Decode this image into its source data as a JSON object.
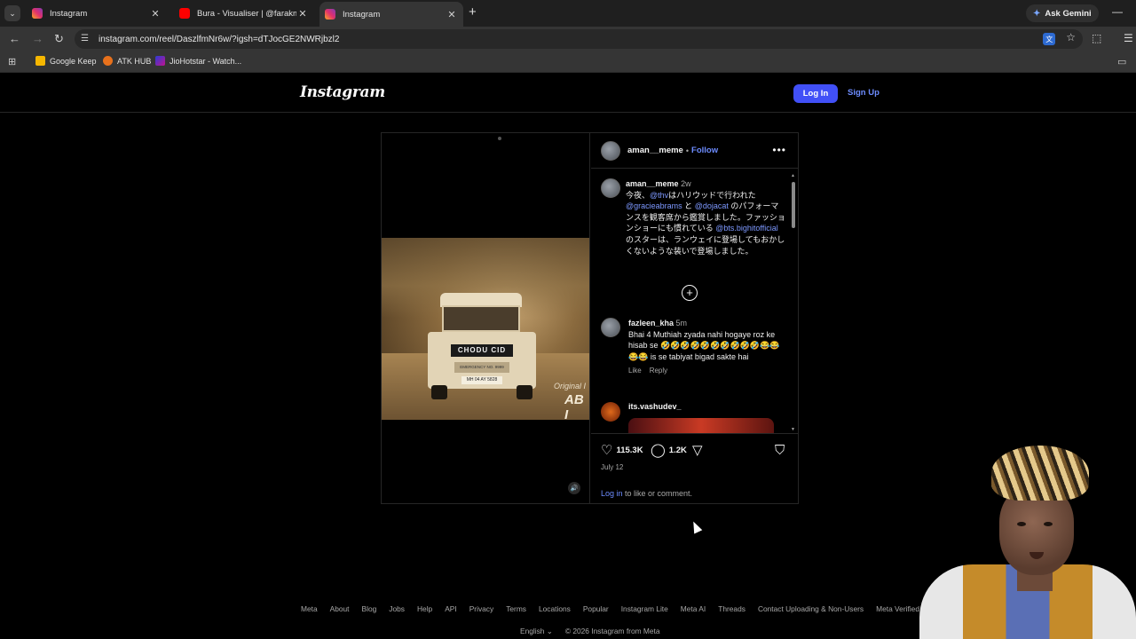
{
  "browser": {
    "tabs": [
      {
        "title": "Instagram",
        "favicon": "instagram-favicon",
        "active": false
      },
      {
        "title": "Bura - Visualiser | @farakmaybe",
        "favicon": "youtube-favicon",
        "active": false
      },
      {
        "title": "Instagram",
        "favicon": "instagram-favicon",
        "active": true
      }
    ],
    "ask_gemini": "Ask Gemini",
    "url": "instagram.com/reel/DaszlfmNr6w/?igsh=dTJocGE2NWRjbzl2",
    "bookmarks": [
      {
        "label": "Google Keep",
        "icon": "google-keep-icon"
      },
      {
        "label": "ATK HUB",
        "icon": "atk-hub-icon"
      },
      {
        "label": "JioHotstar - Watch...",
        "icon": "jiohotstar-icon"
      }
    ]
  },
  "header": {
    "logo": "Instagram",
    "login": "Log In",
    "signup": "Sign Up"
  },
  "post": {
    "video": {
      "plate_text": "CHODU CID",
      "plate_sub": "EMERGENCY NO. 9999",
      "number_plate": "MH 04 AY 5828",
      "overlay_line1": "Original I",
      "overlay_line2": "AB I"
    },
    "username": "aman__meme",
    "follow": "Follow",
    "caption": {
      "username": "aman__meme",
      "time": "2w",
      "p1": "今夜、",
      "m1": "@thv",
      "p2": "はハリウッドで行われた ",
      "m2": "@gracieabrams",
      "p3": " と ",
      "m3": "@dojacat",
      "p4": " のパフォーマンスを観客席から鑑賞しました。ファッションショーにも慣れている ",
      "m4": "@bts.bighitofficial",
      "p5": " のスターは、ランウェイに登場してもおかしくないような装いで登場しました。"
    },
    "comments": [
      {
        "username": "fazleen_kha",
        "time": "5m",
        "text": "Bhai 4 Muthiah zyada nahi hogaye roz ke hisab se 🤣🤣🤣🤣🤣🤣🤣🤣🤣🤣😂😂😂😂 is se tabiyat bigad sakte hai",
        "like": "Like",
        "reply": "Reply"
      },
      {
        "username": "its.vashudev_"
      }
    ],
    "likes": "115.3K",
    "comment_count": "1.2K",
    "date": "July 12",
    "login_prompt_link": "Log in",
    "login_prompt_rest": " to like or comment."
  },
  "footer": {
    "links": [
      "Meta",
      "About",
      "Blog",
      "Jobs",
      "Help",
      "API",
      "Privacy",
      "Terms",
      "Locations",
      "Popular",
      "Instagram Lite",
      "Meta AI",
      "Threads",
      "Contact Uploading & Non-Users",
      "Meta Verified"
    ],
    "language": "English",
    "copyright": "© 2026 Instagram from Meta"
  }
}
